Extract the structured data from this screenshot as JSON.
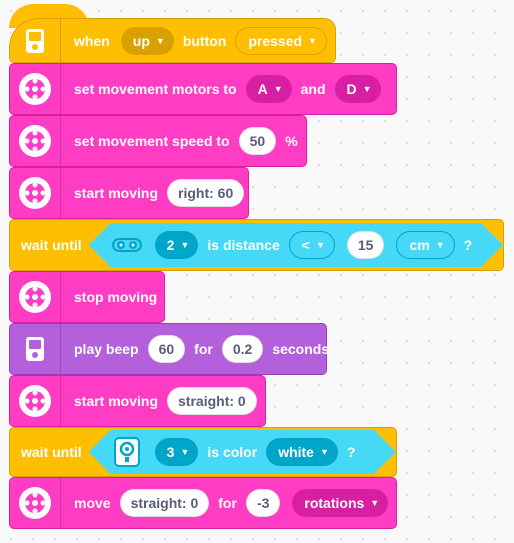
{
  "blocks": {
    "when_button": {
      "label_when": "when",
      "button_value": "up",
      "label_button": "button",
      "state_value": "pressed"
    },
    "set_motors": {
      "label": "set movement motors to",
      "motor_a": "A",
      "label_and": "and",
      "motor_b": "D"
    },
    "set_speed": {
      "label": "set movement speed to",
      "value": "50",
      "unit": "%"
    },
    "start_moving_1": {
      "label": "start moving",
      "value": "right: 60"
    },
    "wait_distance": {
      "label": "wait until",
      "port": "2",
      "label_is": "is distance",
      "comparator": "<",
      "value": "15",
      "unit": "cm",
      "question": "?"
    },
    "stop_moving": {
      "label": "stop moving"
    },
    "play_beep": {
      "label": "play beep",
      "note": "60",
      "label_for": "for",
      "duration": "0.2",
      "label_seconds": "seconds"
    },
    "start_moving_2": {
      "label": "start moving",
      "value": "straight: 0"
    },
    "wait_color": {
      "label": "wait until",
      "port": "3",
      "label_is": "is color",
      "color_value": "white",
      "question": "?"
    },
    "move": {
      "label": "move",
      "direction": "straight: 0",
      "label_for": "for",
      "amount": "-3",
      "unit": "rotations"
    }
  },
  "colors": {
    "motor": "#ff3cc4",
    "sound": "#b45fdb",
    "event": "#ffbf00",
    "sensor": "#45d8f7"
  },
  "icons": {
    "hub": "hub-icon",
    "motor": "motor-icon",
    "distance_sensor": "distance-sensor-icon",
    "color_sensor": "color-sensor-icon"
  }
}
